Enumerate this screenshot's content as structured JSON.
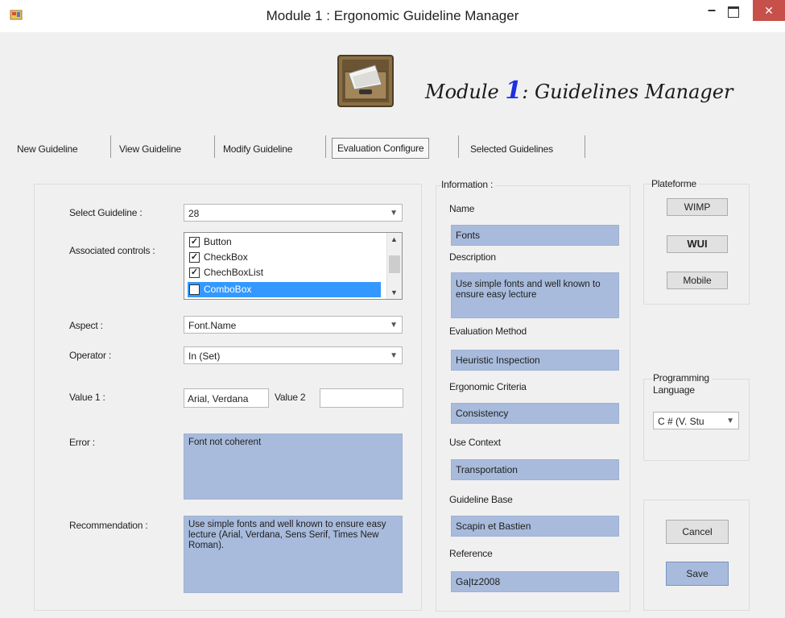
{
  "window": {
    "title": "Module 1 : Ergonomic Guideline Manager",
    "minimize": "–",
    "close": "✕"
  },
  "header": {
    "title_prefix": "Module ",
    "title_number": "1",
    "title_suffix": ": Guidelines Manager"
  },
  "tabs": [
    {
      "label": "New Guideline"
    },
    {
      "label": "View Guideline"
    },
    {
      "label": "Modify Guideline"
    },
    {
      "label": "Evaluation Configure",
      "active": true
    },
    {
      "label": "Selected Guidelines"
    }
  ],
  "form": {
    "select_guideline_label": "Select Guideline :",
    "select_guideline_value": "28",
    "associated_controls_label": "Associated controls :",
    "associated_controls": [
      {
        "label": "Button",
        "checked": true
      },
      {
        "label": "CheckBox",
        "checked": true
      },
      {
        "label": "ChechBoxList",
        "checked": true
      },
      {
        "label": "ComboBox",
        "checked": true,
        "selected": true
      }
    ],
    "aspect_label": "Aspect :",
    "aspect_value": "Font.Name",
    "operator_label": "Operator :",
    "operator_value": "In (Set)",
    "value1_label": "Value 1 :",
    "value1": "Arial, Verdana",
    "value2_label": "Value 2",
    "value2": "",
    "error_label": "Error :",
    "error_text": "Font not coherent",
    "recommendation_label": "Recommendation :",
    "recommendation_text": "Use simple fonts and well known to ensure easy lecture (Arial, Verdana, Sens Serif, Times New Roman)."
  },
  "information": {
    "group_label": "Information :",
    "name_label": "Name",
    "name_value": "Fonts",
    "description_label": "Description",
    "description_value": "Use simple fonts and well known to ensure easy lecture",
    "evaluation_method_label": "Evaluation Method",
    "evaluation_method_value": "Heuristic Inspection",
    "ergonomic_criteria_label": "Ergonomic Criteria",
    "ergonomic_criteria_value": "Consistency",
    "use_context_label": "Use Context",
    "use_context_value": "Transportation",
    "guideline_base_label": "Guideline Base",
    "guideline_base_value": "Scapin et Bastien",
    "reference_label": "Reference",
    "reference_value": "Ga|tz2008"
  },
  "platform": {
    "group_label": "Plateforme",
    "wimp": "WIMP",
    "wui": "WUI",
    "mobile": "Mobile"
  },
  "programming": {
    "group_label_line1": "Programming",
    "group_label_line2": "Language",
    "value": "C # (V. Stu"
  },
  "actions": {
    "cancel": "Cancel",
    "save": "Save"
  },
  "icons": {
    "app_icon": "app-icon",
    "header_icon": "file-cabinet-icon",
    "combo_arrow": "chevron-down-icon",
    "check": "check-icon"
  }
}
